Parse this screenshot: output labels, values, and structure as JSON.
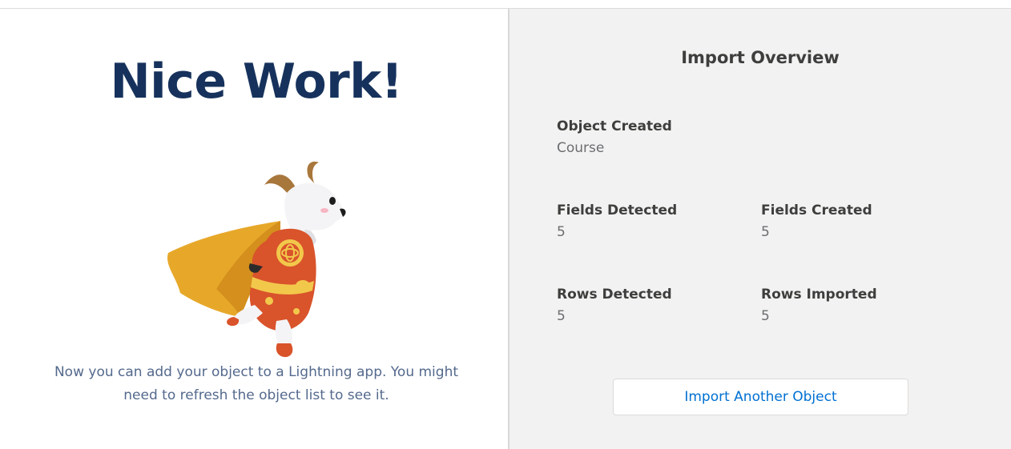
{
  "success": {
    "headline": "Nice Work!",
    "message_line1": "Now you can add your object to a Lightning app. You might",
    "message_line2": "need to refresh the object list to see it."
  },
  "overview": {
    "title": "Import Overview",
    "object_created": {
      "label": "Object Created",
      "value": "Course"
    },
    "fields_detected": {
      "label": "Fields Detected",
      "value": "5"
    },
    "fields_created": {
      "label": "Fields Created",
      "value": "5"
    },
    "rows_detected": {
      "label": "Rows Detected",
      "value": "5"
    },
    "rows_imported": {
      "label": "Rows Imported",
      "value": "5"
    },
    "import_button_label": "Import Another Object"
  },
  "colors": {
    "headline": "#16325c",
    "link": "#0070d2",
    "panel_bg": "#f2f2f2"
  }
}
